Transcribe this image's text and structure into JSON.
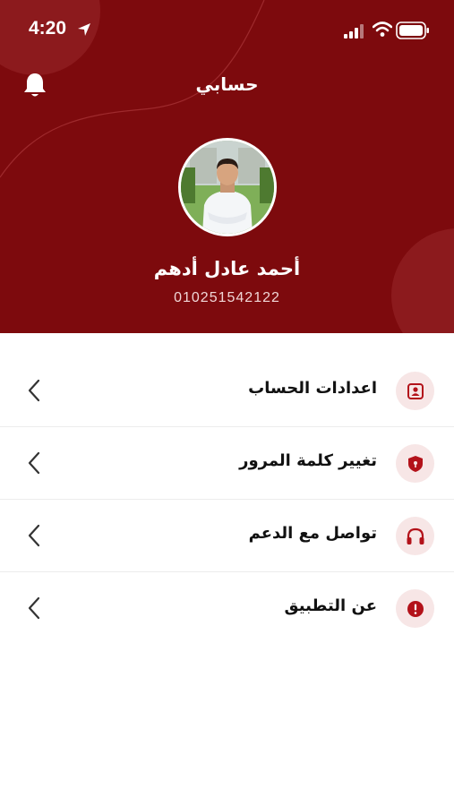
{
  "status": {
    "time": "4:20"
  },
  "header": {
    "title": "حسابي"
  },
  "profile": {
    "name": "أحمد عادل أدهم",
    "phone": "010251542122"
  },
  "menu": [
    {
      "label": "اعدادات الحساب",
      "icon": "user-card-icon"
    },
    {
      "label": "تغيير كلمة المرور",
      "icon": "shield-lock-icon"
    },
    {
      "label": "تواصل مع الدعم",
      "icon": "headphones-icon"
    },
    {
      "label": "عن التطبيق",
      "icon": "info-icon"
    }
  ],
  "colors": {
    "brand": "#7d0a0d",
    "icon_bg": "#f7e6e6",
    "icon_fg": "#b3121a"
  }
}
